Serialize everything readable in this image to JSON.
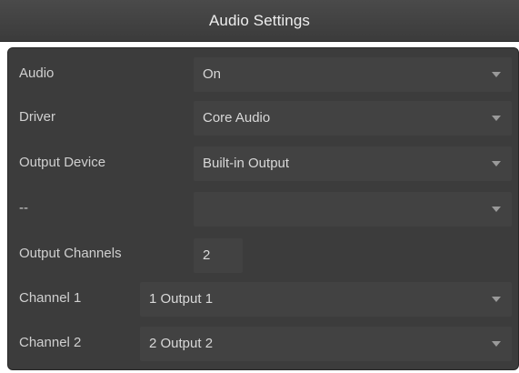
{
  "window": {
    "title": "Audio Settings"
  },
  "rows": [
    {
      "label": "Audio",
      "value": "On"
    },
    {
      "label": "Driver",
      "value": "Core Audio"
    },
    {
      "label": "Output Device",
      "value": "Built-in Output"
    },
    {
      "label": "--",
      "value": ""
    },
    {
      "label": "Output Channels",
      "value": "2"
    },
    {
      "label": "Channel 1",
      "value": "1 Output 1"
    },
    {
      "label": "Channel 2",
      "value": "2 Output 2"
    }
  ],
  "colors": {
    "title_bar": "#3f3f3f",
    "panel": "#3c3c3c",
    "field": "#424242",
    "text": "#d0d0d0",
    "arrow": "#9a9a9a"
  },
  "icons": {
    "dropdown_arrow": "chevron-down-icon"
  }
}
